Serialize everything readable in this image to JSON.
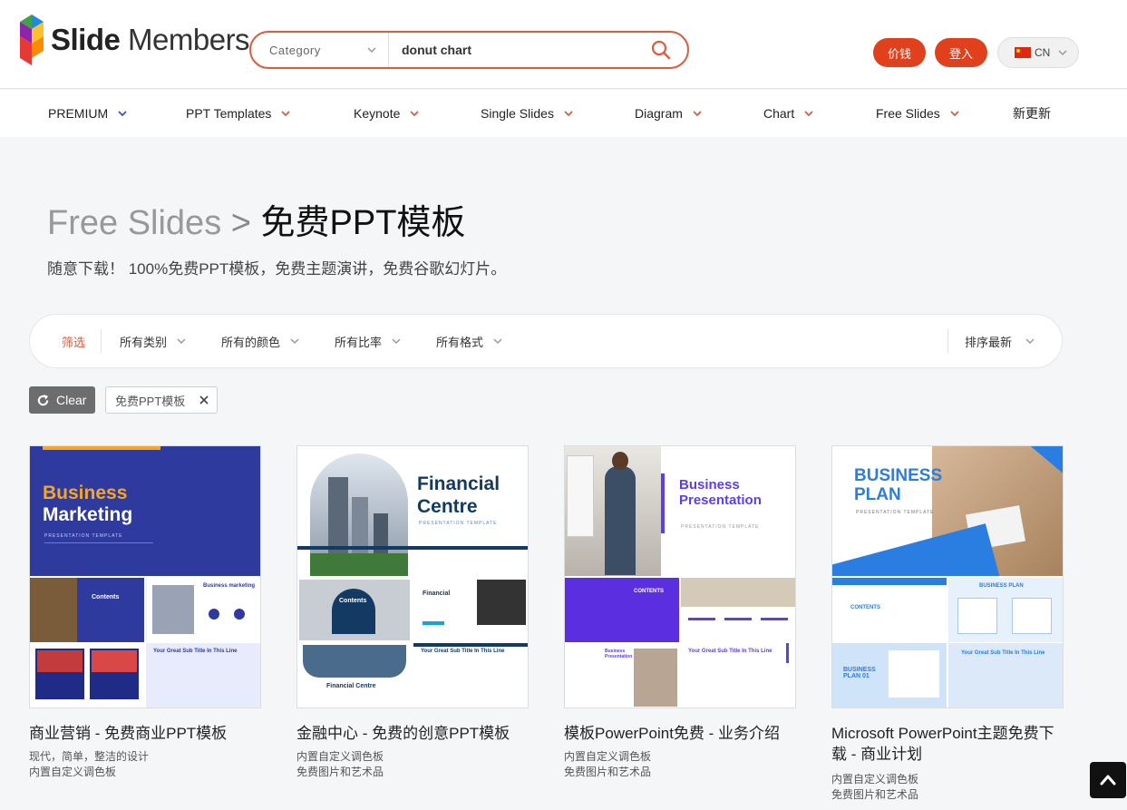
{
  "brand": {
    "logo_bold": "Slide",
    "logo_light": " Members"
  },
  "search": {
    "category_label": "Category",
    "query": "donut chart",
    "placeholder": ""
  },
  "header_buttons": {
    "price": "价钱",
    "login": "登入",
    "lang": "CN"
  },
  "nav": [
    {
      "label": "PREMIUM",
      "chevron_color": "#3b4fd6"
    },
    {
      "label": "PPT Templates",
      "chevron_color": "#e05a3c"
    },
    {
      "label": "Keynote",
      "chevron_color": "#e05a3c"
    },
    {
      "label": "Single Slides",
      "chevron_color": "#e05a3c"
    },
    {
      "label": "Diagram",
      "chevron_color": "#e05a3c"
    },
    {
      "label": "Chart",
      "chevron_color": "#e05a3c"
    },
    {
      "label": "Free Slides",
      "chevron_color": "#e05a3c"
    },
    {
      "label": "新更新"
    }
  ],
  "hero": {
    "crumb": "Free Slides",
    "separator": " > ",
    "title": "免费PPT模板",
    "subtitle": "随意下载！ 100%免费PPT模板，免费主题演讲，免费谷歌幻灯片。"
  },
  "filters": {
    "label": "筛选",
    "items": [
      "所有类别",
      "所有的颜色",
      "所有比率",
      "所有格式"
    ],
    "sort": "排序最新"
  },
  "active_filters": {
    "clear": "Clear",
    "tags": [
      "免费PPT模板"
    ]
  },
  "cards": [
    {
      "title": "商业营销 - 免费商业PPT模板",
      "lines": [
        "现代，简单，整洁的设计",
        "内置自定义调色板"
      ],
      "thumb": {
        "main_title_1": "Business",
        "main_title_2": "Marketing",
        "main_sub": "PRESENTATION TEMPLATE",
        "s1": "Contents",
        "s2": "Business marketing",
        "s4": "Your Great Sub Title In This Line"
      }
    },
    {
      "title": "金融中心 - 免费的创意PPT模板",
      "lines": [
        "内置自定义调色板",
        "免费图片和艺术品"
      ],
      "thumb": {
        "main_title_1": "Financial",
        "main_title_2": "Centre",
        "main_sub": "PRESENTATION TEMPLATE",
        "s1": "Contents",
        "s2": "Financial",
        "s3": "Financial Centre",
        "s4": "Your Great Sub Title In This Line"
      }
    },
    {
      "title": "模板PowerPoint免费 - 业务介绍",
      "lines": [
        "内置自定义调色板",
        "免费图片和艺术品"
      ],
      "thumb": {
        "main_title_1": "Business",
        "main_title_2": "Presentation",
        "main_sub": "PRESENTATION TEMPLATE",
        "s1": "CONTENTS",
        "s3": "Business Presentation",
        "s4": "Your Great Sub Title In This Line"
      }
    },
    {
      "title": "Microsoft PowerPoint主题免费下载 - 商业计划",
      "lines": [
        "内置自定义调色板",
        "免费图片和艺术品"
      ],
      "thumb": {
        "main_title_1": "BUSINESS",
        "main_title_2": "PLAN",
        "main_sub": "PRESENTATION TEMPLATE",
        "s1": "CONTENTS",
        "s2": "BUSINESS PLAN",
        "s3": "BUSINESS PLAN 01",
        "s4": "Your Great Sub Title In This Line"
      }
    }
  ],
  "colors": {
    "accent": "#e1401d",
    "search_border": "#e05a3c",
    "premium": "#3b4fd6"
  },
  "icons": [
    "logo-cube-icon",
    "chevron-down-icon",
    "search-icon",
    "cn-flag-icon",
    "refresh-icon",
    "close-icon",
    "arrow-up-icon"
  ]
}
